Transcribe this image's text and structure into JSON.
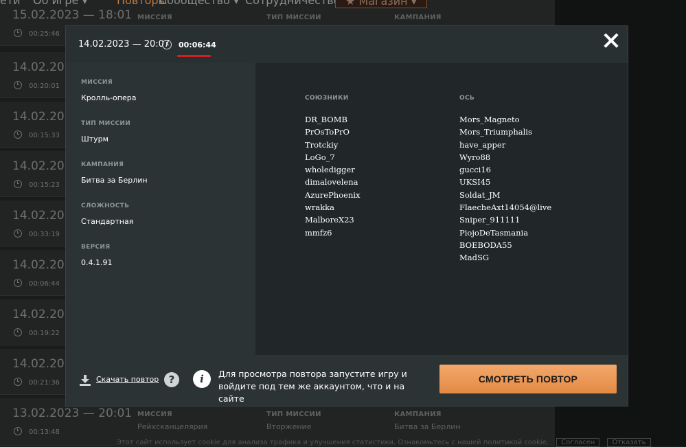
{
  "background": {
    "nav": [
      "ети",
      "Об игре ▾",
      "Повторы",
      "Сообщество ▾",
      "Сотрудничество",
      "★ Магазин ▾"
    ],
    "rows": [
      {
        "date": "15.02.2023 — 18:01",
        "duration": "00:25:46",
        "col1_head": "МИССИЯ",
        "col2_head": "ТИП МИССИИ",
        "col3_head": "КАМПАНИЯ"
      },
      {
        "date": "14.02.2023",
        "duration": "00:20:01"
      },
      {
        "date": "14.02.2023",
        "duration": "00:15:33"
      },
      {
        "date": "14.02.2023",
        "duration": "00:15:23"
      },
      {
        "date": "14.02.2023",
        "duration": "00:33:19"
      },
      {
        "date": "14.02.2023",
        "duration": "00:06:44"
      },
      {
        "date": "14.02.2023",
        "duration": "00:19:22"
      },
      {
        "date": "14.02.2023",
        "duration": "00:21:36"
      },
      {
        "date": "13.02.2023 — 20:01",
        "duration": "00:13:48",
        "col1_head": "МИССИЯ",
        "col1_val": "Рейхсканцелярия",
        "col2_head": "ТИП МИССИИ",
        "col2_val": "Вторжение",
        "col3_head": "КАМПАНИЯ",
        "col3_val": "Битва за Берлин"
      }
    ],
    "cookie_text": "Этот сайт использует cookie для анализа трафика и улучшения статистики. Ознакомьтесь с нашей политикой cookie.",
    "cookie_agree": "Согласен",
    "cookie_decline": "Отказать"
  },
  "modal": {
    "datetime": "14.02.2023 — 20:07",
    "duration": "00:06:44",
    "info": [
      {
        "label": "МИССИЯ",
        "value": "Кролль-опера"
      },
      {
        "label": "ТИП МИССИИ",
        "value": "Штурм"
      },
      {
        "label": "КАМПАНИЯ",
        "value": "Битва за Берлин"
      },
      {
        "label": "СЛОЖНОСТЬ",
        "value": "Стандартная"
      },
      {
        "label": "ВЕРСИЯ",
        "value": "0.4.1.91"
      }
    ],
    "allies_head": "СОЮЗНИКИ",
    "axis_head": "ОСЬ",
    "allies": [
      "DR_BOMB",
      "PrOsToPrO",
      "Trotckiy",
      "LoGo_7",
      "wholedigger",
      "dimalovelena",
      "AzurePhoenix",
      "wrakka",
      "MalboreX23",
      "mmfz6"
    ],
    "axis": [
      "Mors_Magneto",
      "Mors_Triumphalis",
      "have_apper",
      "Wyro88",
      "gucci16",
      "UKSI45",
      "Soldat_JM",
      "FlaecheAxt14054@live",
      "Sniper_911111",
      "PiojoDeTasmania",
      "BOEBODA55",
      "MadSG"
    ],
    "download_label": "Скачать повтор",
    "hint_text": "Для просмотра повтора запустите игру и войдите под тем же аккаунтом, что и на сайте",
    "watch_button": "СМОТРЕТЬ ПОВТОР"
  }
}
